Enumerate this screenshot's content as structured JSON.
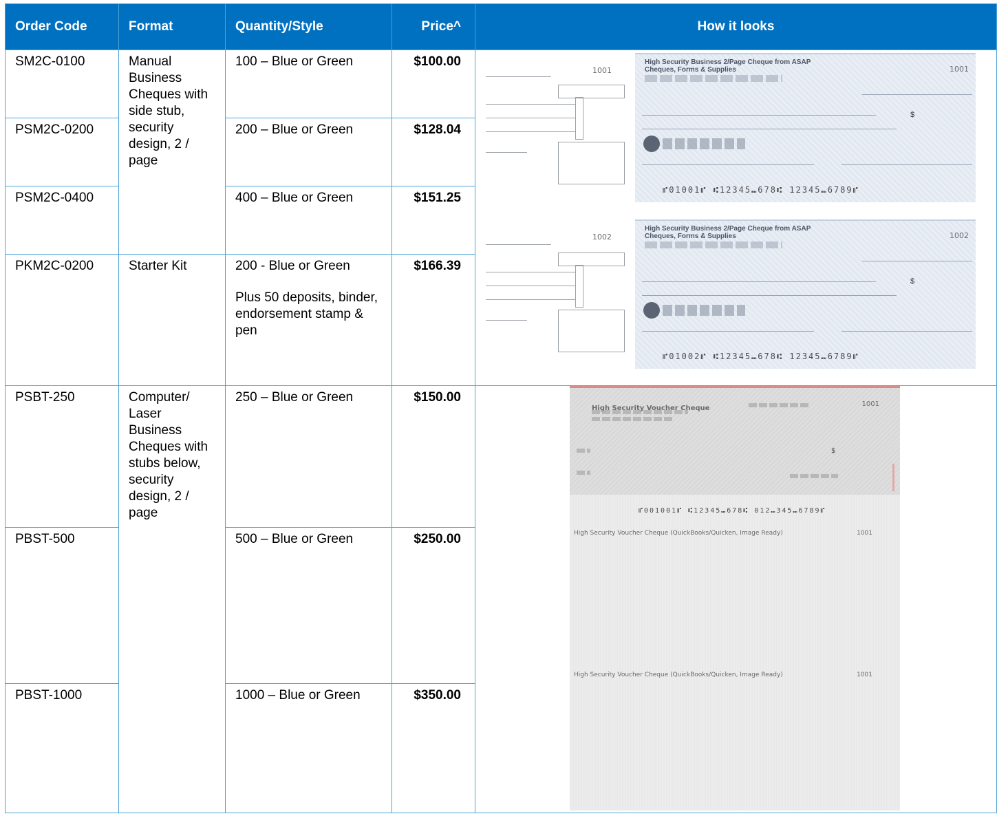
{
  "table": {
    "headers": {
      "code": "Order Code",
      "format": "Format",
      "qty": "Quantity/Style",
      "price": "Price^",
      "look": "How it looks"
    },
    "rows": [
      {
        "code": "SM2C-0100",
        "qty": "100 – Blue or Green",
        "price": "$100.00"
      },
      {
        "code": "PSM2C-0200",
        "qty": "200 – Blue or Green",
        "price": "$128.04"
      },
      {
        "code": "PSM2C-0400",
        "qty": "400 – Blue or Green",
        "price": "$151.25"
      },
      {
        "code": "PKM2C-0200",
        "qty": "200 - Blue or Green",
        "qty_note": "Plus 50 deposits, binder, endorsement stamp & pen",
        "price": "$166.39"
      },
      {
        "code": "PSBT-250",
        "qty": "250 – Blue or Green",
        "price": "$150.00"
      },
      {
        "code": "PBST-500",
        "qty": "500 – Blue or Green",
        "price": "$250.00"
      },
      {
        "code": "PBST-1000",
        "qty": "1000 – Blue or Green",
        "price": "$350.00"
      }
    ],
    "formats": {
      "manual": "Manual Business Cheques with side stub, security design, 2 / page",
      "starter": "Starter Kit",
      "laser": "Computer/ Laser Business Cheques with stubs below, security design, 2 / page"
    }
  },
  "samples": {
    "manual": {
      "cheques": [
        {
          "number": "1001",
          "heading": "High Security Business 2/Page Cheque from ASAP Cheques, Forms & Supplies",
          "micr": "⑈01001⑈ ⑆12345⑉678⑆ 12345⑉6789⑈"
        },
        {
          "number": "1002",
          "heading": "High Security Business 2/Page Cheque from ASAP Cheques, Forms & Supplies",
          "micr": "⑈01002⑈ ⑆12345⑉678⑆ 12345⑉6789⑈"
        }
      ],
      "currency": "$"
    },
    "laser": {
      "number": "1001",
      "heading": "High Security Voucher Cheque",
      "micr": "⑈001001⑈ ⑆12345⑉678⑆ 012⑉345⑉6789⑈",
      "stub_title": "High Security Voucher Cheque (QuickBooks/Quicken, Image Ready)",
      "currency": "$"
    }
  }
}
